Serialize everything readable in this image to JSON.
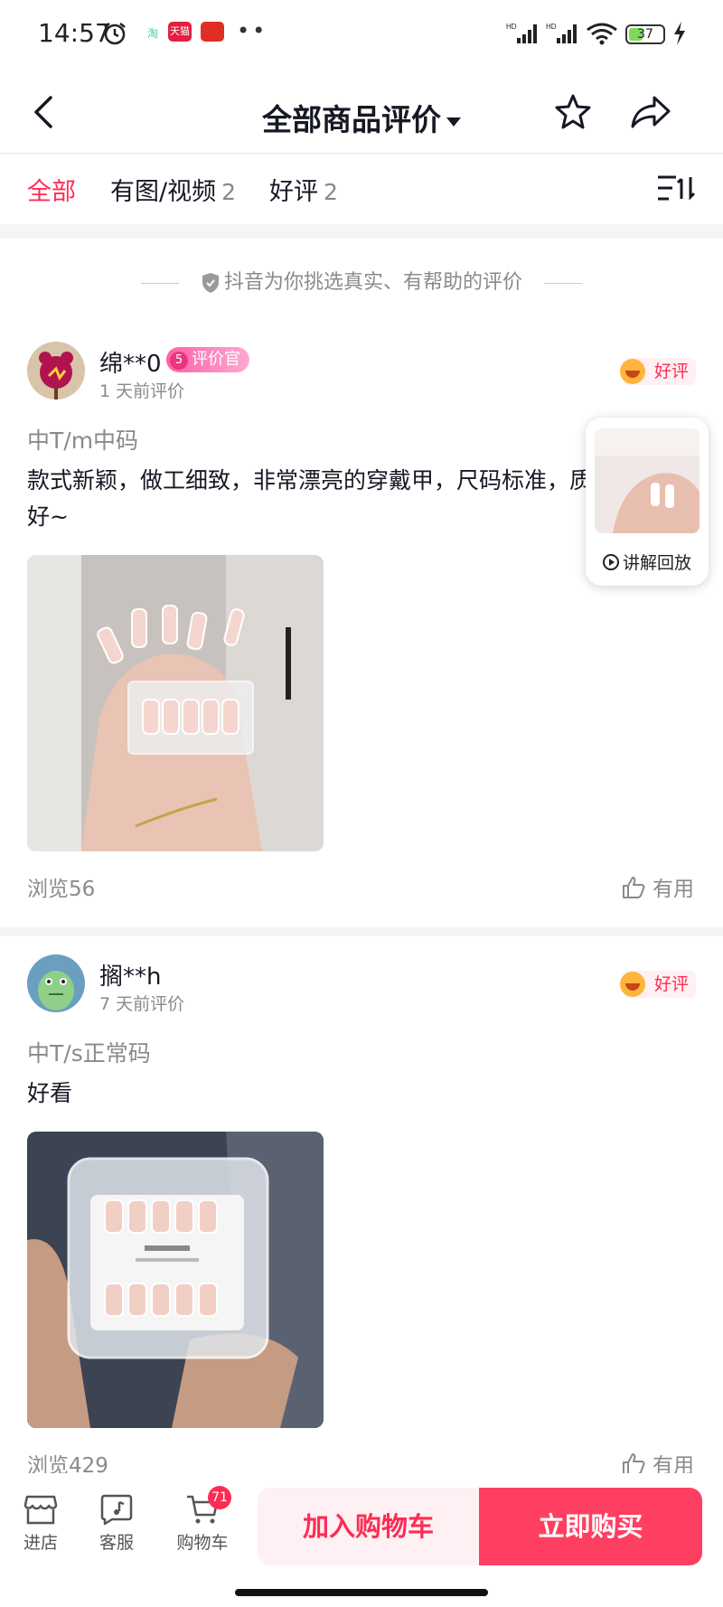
{
  "status_bar": {
    "time": "14:57",
    "battery": "37",
    "app_icons": [
      "淘",
      "天猫"
    ]
  },
  "header": {
    "title": "全部商品评价"
  },
  "tabs": [
    {
      "label": "全部",
      "count": ""
    },
    {
      "label": "有图/视频",
      "count": "2"
    },
    {
      "label": "好评",
      "count": "2"
    }
  ],
  "notice": "抖音为你挑选真实、有帮助的评价",
  "reviews": [
    {
      "user": "绵**0",
      "badge_level": "5",
      "badge_label": "评价官",
      "time": "1 天前评价",
      "rating": "好评",
      "spec": "中T/m中码",
      "text": "款式新颖，做工细致，非常漂亮的穿戴甲，尺码标准，质量很好~",
      "views": "浏览56",
      "helpful": "有用"
    },
    {
      "user": "搁**h",
      "time": "7 天前评价",
      "rating": "好评",
      "spec": "中T/s正常码",
      "text": "好看",
      "views": "浏览429",
      "helpful": "有用"
    }
  ],
  "float_video": {
    "label": "讲解回放"
  },
  "bottom_bar": {
    "store": "进店",
    "service": "客服",
    "cart": "购物车",
    "cart_count": "71",
    "add_to_cart": "加入购物车",
    "buy_now": "立即购买"
  },
  "colors": {
    "accent": "#fe2c55",
    "buy_button": "#fe3f62",
    "add_cart_bg": "#fff0f3"
  }
}
